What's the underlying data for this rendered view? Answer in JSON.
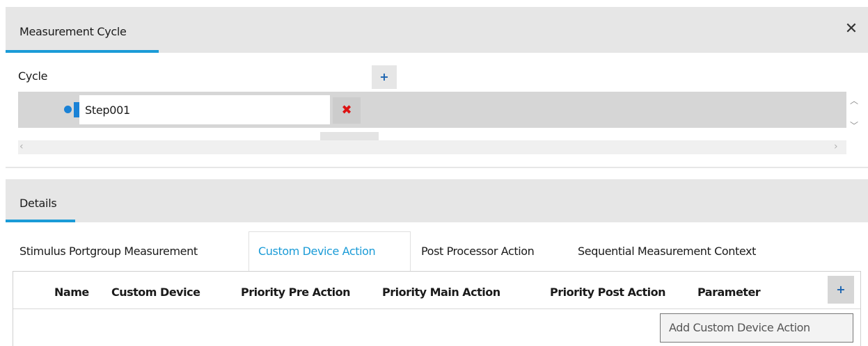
{
  "panel": {
    "title": "Measurement Cycle",
    "close_icon": "✕"
  },
  "cycle": {
    "label": "Cycle",
    "add_icon": "+",
    "steps": [
      {
        "name": "Step001",
        "delete_icon": "✖"
      }
    ],
    "scroll_up": "^",
    "scroll_down": "v",
    "scroll_left": "<",
    "scroll_right": ">"
  },
  "details": {
    "title": "Details",
    "tabs": [
      {
        "label": "Stimulus Portgroup Measurement"
      },
      {
        "label": "Custom Device Action",
        "active": true
      },
      {
        "label": "Post Processor Action"
      },
      {
        "label": "Sequential Measurement Context"
      }
    ],
    "columns": [
      "Name",
      "Custom Device",
      "Priority Pre Action",
      "Priority Main Action",
      "Priority Post Action",
      "Parameter"
    ],
    "add_icon": "+",
    "tooltip": "Add Custom Device Action"
  },
  "colors": {
    "accent": "#1a9bd7",
    "delete": "#dd1111",
    "plus": "#1a63b0"
  }
}
